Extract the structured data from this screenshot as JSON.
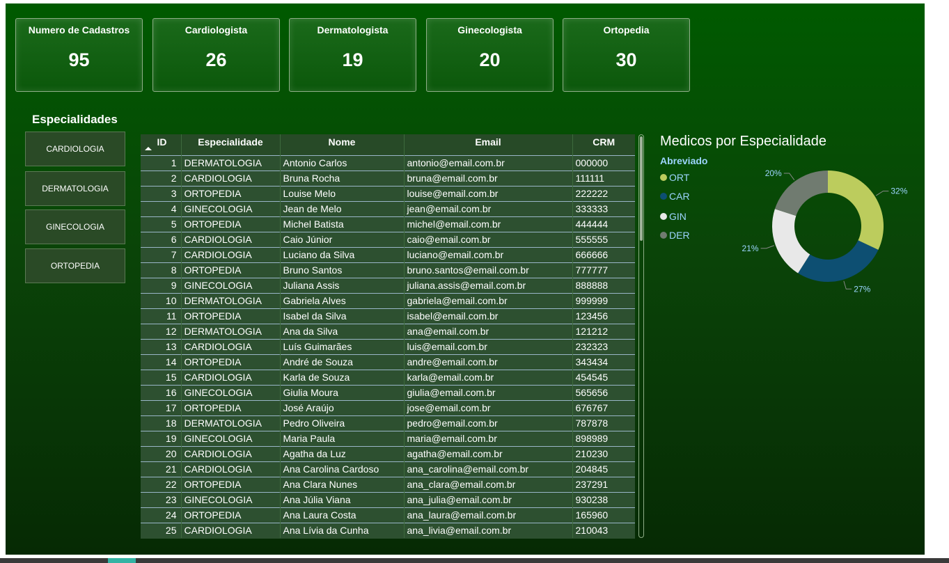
{
  "cards": [
    {
      "title": "Numero de Cadastros",
      "value": "95"
    },
    {
      "title": "Cardiologista",
      "value": "26"
    },
    {
      "title": "Dermatologista",
      "value": "19"
    },
    {
      "title": "Ginecologista",
      "value": "20"
    },
    {
      "title": "Ortopedia",
      "value": "30"
    }
  ],
  "slicer": {
    "title": "Especialidades",
    "items": [
      "CARDIOLOGIA",
      "DERMATOLOGIA",
      "GINECOLOGIA",
      "ORTOPEDIA"
    ]
  },
  "table": {
    "headers": [
      "ID",
      "Especialidade",
      "Nome",
      "Email",
      "CRM"
    ],
    "sort_icon": "sort-ascending-icon",
    "rows": [
      [
        "1",
        "DERMATOLOGIA",
        "Antonio Carlos",
        "antonio@email.com.br",
        "000000"
      ],
      [
        "2",
        "CARDIOLOGIA",
        "Bruna Rocha",
        "bruna@email.com.br",
        "111111"
      ],
      [
        "3",
        "ORTOPEDIA",
        "Louise Melo",
        "louise@email.com.br",
        "222222"
      ],
      [
        "4",
        "GINECOLOGIA",
        "Jean de Melo",
        "jean@email.com.br",
        "333333"
      ],
      [
        "5",
        "ORTOPEDIA",
        "Michel Batista",
        "michel@email.com.br",
        "444444"
      ],
      [
        "6",
        "CARDIOLOGIA",
        "Caio Júnior",
        "caio@email.com.br",
        "555555"
      ],
      [
        "7",
        "CARDIOLOGIA",
        "Luciano da Silva",
        "luciano@email.com.br",
        "666666"
      ],
      [
        "8",
        "ORTOPEDIA",
        "Bruno Santos",
        "bruno.santos@email.com.br",
        "777777"
      ],
      [
        "9",
        "GINECOLOGIA",
        "Juliana Assis",
        "juliana.assis@email.com.br",
        "888888"
      ],
      [
        "10",
        "DERMATOLOGIA",
        "Gabriela Alves",
        "gabriela@email.com.br",
        "999999"
      ],
      [
        "11",
        "ORTOPEDIA",
        "Isabel da Silva",
        "isabel@email.com.br",
        "123456"
      ],
      [
        "12",
        "DERMATOLOGIA",
        "Ana da Silva",
        "ana@email.com.br",
        "121212"
      ],
      [
        "13",
        "CARDIOLOGIA",
        "Luís Guimarães",
        "luis@email.com.br",
        "232323"
      ],
      [
        "14",
        "ORTOPEDIA",
        "André de Souza",
        "andre@email.com.br",
        "343434"
      ],
      [
        "15",
        "CARDIOLOGIA",
        "Karla de Souza",
        "karla@email.com.br",
        "454545"
      ],
      [
        "16",
        "GINECOLOGIA",
        "Giulia Moura",
        "giulia@email.com.br",
        "565656"
      ],
      [
        "17",
        "ORTOPEDIA",
        "José Araújo",
        "jose@email.com.br",
        "676767"
      ],
      [
        "18",
        "DERMATOLOGIA",
        "Pedro Oliveira",
        "pedro@email.com.br",
        "787878"
      ],
      [
        "19",
        "GINECOLOGIA",
        "Maria Paula",
        "maria@email.com.br",
        "898989"
      ],
      [
        "20",
        "CARDIOLOGIA",
        "Agatha da Luz",
        "agatha@email.com.br",
        "210230"
      ],
      [
        "21",
        "CARDIOLOGIA",
        "Ana Carolina Cardoso",
        "ana_carolina@email.com.br",
        "204845"
      ],
      [
        "22",
        "ORTOPEDIA",
        "Ana Clara Nunes",
        "ana_clara@email.com.br",
        "237291"
      ],
      [
        "23",
        "GINECOLOGIA",
        "Ana Júlia Viana",
        "ana_julia@email.com.br",
        "930238"
      ],
      [
        "24",
        "ORTOPEDIA",
        "Ana Laura Costa",
        "ana_laura@email.com.br",
        "165960"
      ],
      [
        "25",
        "CARDIOLOGIA",
        "Ana Lívia da Cunha",
        "ana_livia@email.com.br",
        "210043"
      ]
    ]
  },
  "chart": {
    "title": "Medicos por Especialidade",
    "legend_title": "Abreviado"
  },
  "chart_data": {
    "type": "pie",
    "donut": true,
    "title": "Medicos por Especialidade",
    "legend_title": "Abreviado",
    "legend_placement": "left",
    "series": [
      {
        "name": "ORT",
        "value": 32,
        "label": "32%",
        "color": "#bccc5d"
      },
      {
        "name": "CAR",
        "value": 27,
        "label": "27%",
        "color": "#0d4f72"
      },
      {
        "name": "GIN",
        "value": 21,
        "label": "21%",
        "color": "#e8e8e8"
      },
      {
        "name": "DER",
        "value": 20,
        "label": "20%",
        "color": "#707b70"
      }
    ]
  },
  "colors": {
    "label_text": "#9dd5ff"
  }
}
